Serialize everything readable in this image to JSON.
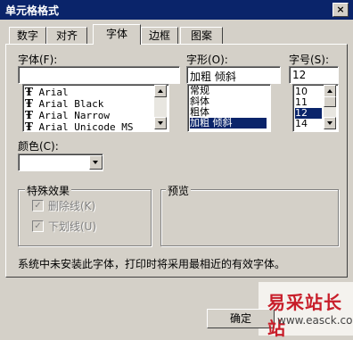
{
  "window": {
    "title": "单元格格式",
    "close_glyph": "×"
  },
  "tabs": [
    {
      "label": "数字"
    },
    {
      "label": "对齐"
    },
    {
      "label": "字体",
      "active": true
    },
    {
      "label": "边框"
    },
    {
      "label": "图案"
    }
  ],
  "font": {
    "label": "字体(F):",
    "value": "",
    "items": [
      "Arial",
      "Arial Black",
      "Arial Narrow",
      "Arial Unicode MS"
    ],
    "icon": "truetype-icon"
  },
  "style": {
    "label": "字形(O):",
    "value": "加粗 倾斜",
    "items": [
      "常规",
      "斜体",
      "粗体",
      "加粗 倾斜"
    ],
    "selected_index": 3
  },
  "size": {
    "label": "字号(S):",
    "value": "12",
    "items": [
      "10",
      "11",
      "12",
      "14"
    ],
    "selected_index": 2
  },
  "color": {
    "label": "颜色(C):",
    "value": ""
  },
  "effects": {
    "label": "特殊效果",
    "strikethrough": {
      "label": "删除线(K)",
      "checked": true
    },
    "underline": {
      "label": "下划线(U)",
      "checked": true
    }
  },
  "preview": {
    "label": "预览"
  },
  "note": "系统中未安装此字体，打印时将采用最相近的有效字体。",
  "buttons": {
    "ok": "确定"
  },
  "watermark": {
    "text": "易采站长站",
    "sub": "www.easck.com"
  },
  "colors": {
    "titlebar": "#0a246a",
    "face": "#d4d0c8",
    "selection": "#0a246a",
    "watermark": "#c81e2a"
  }
}
